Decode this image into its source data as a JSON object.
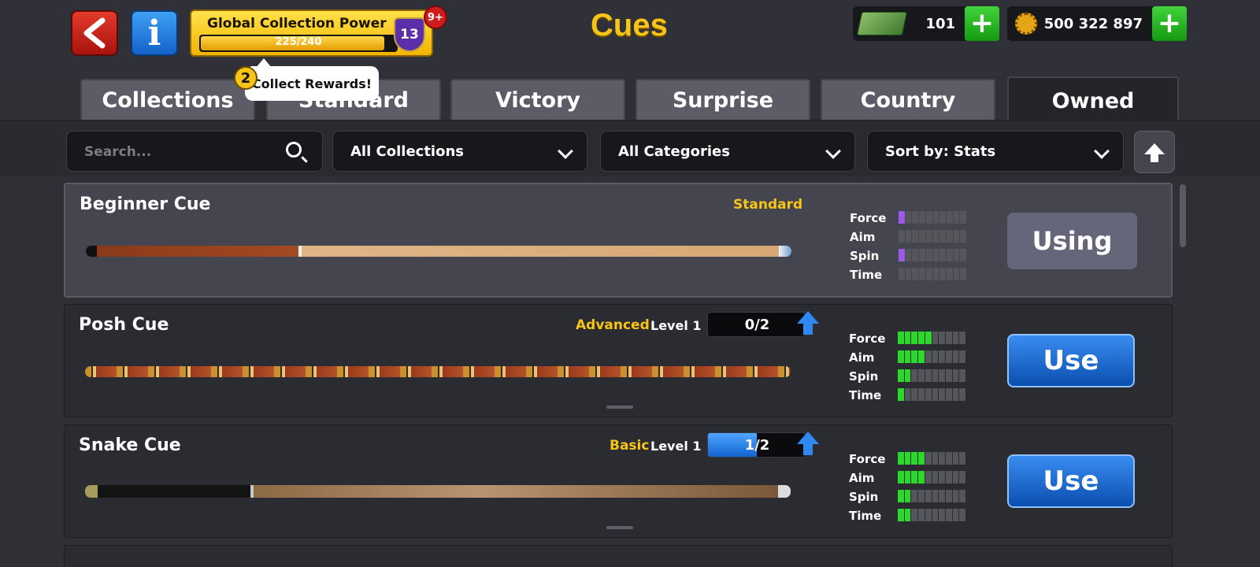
{
  "header": {
    "title": "Cues",
    "collection": {
      "label": "Global Collection Power",
      "progress_text": "225/240",
      "progress": 0.9375,
      "level": "13",
      "notif": "9+"
    },
    "cash": {
      "value": "101"
    },
    "coins": {
      "value": "500 322 897"
    },
    "icons": [
      "back-arrow-icon",
      "info-icon",
      "cash-icon",
      "coin-icon",
      "plus-icon",
      "shield-icon"
    ]
  },
  "tooltip": {
    "text": "Collect Rewards!",
    "badge": "2"
  },
  "tabs": [
    {
      "label": "Collections",
      "active": false
    },
    {
      "label": "Standard",
      "active": false
    },
    {
      "label": "Victory",
      "active": false
    },
    {
      "label": "Surprise",
      "active": false
    },
    {
      "label": "Country",
      "active": false
    },
    {
      "label": "Owned",
      "active": true
    }
  ],
  "filters": {
    "search_placeholder": "Search...",
    "collections": "All Collections",
    "categories": "All Categories",
    "sort": "Sort by: Stats"
  },
  "stat_labels": {
    "force": "Force",
    "aim": "Aim",
    "spin": "Spin",
    "time": "Time"
  },
  "cues": [
    {
      "name": "Beginner Cue",
      "category": "Standard",
      "button": "Using",
      "stats": {
        "force": 1,
        "aim": 0,
        "spin": 1,
        "time": 0
      },
      "stat_color": "#9b59e8"
    },
    {
      "name": "Posh Cue",
      "category": "Advanced",
      "level_label": "Level 1",
      "upgrade": "0/2",
      "upgrade_progress": 0.0,
      "button": "Use",
      "stats": {
        "force": 5,
        "aim": 4,
        "spin": 2,
        "time": 1
      },
      "stat_color": "#2bd82b"
    },
    {
      "name": "Snake Cue",
      "category": "Basic",
      "level_label": "Level 1",
      "upgrade": "1/2",
      "upgrade_progress": 0.5,
      "button": "Use",
      "stats": {
        "force": 4,
        "aim": 4,
        "spin": 2,
        "time": 2
      },
      "stat_color": "#2bd82b"
    }
  ]
}
